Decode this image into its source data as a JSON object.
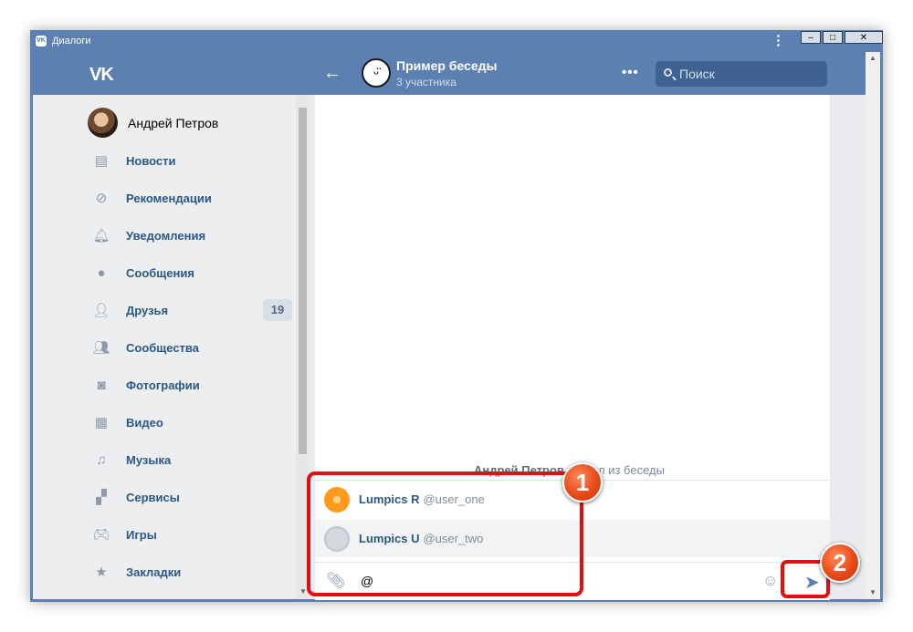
{
  "window": {
    "title": "Диалоги",
    "logo": "VK"
  },
  "header": {
    "logo": "VK",
    "chat_title": "Пример беседы",
    "chat_subtitle": "3 участника",
    "more": "•••",
    "search_placeholder": "Поиск",
    "back_icon": "arrow-left-icon"
  },
  "sidebar": {
    "profile_name": "Андрей Петров",
    "items": [
      {
        "label": "Новости",
        "icon": "news-icon"
      },
      {
        "label": "Рекомендации",
        "icon": "compass-icon"
      },
      {
        "label": "Уведомления",
        "icon": "bell-icon"
      },
      {
        "label": "Сообщения",
        "icon": "message-icon"
      },
      {
        "label": "Друзья",
        "icon": "user-icon",
        "badge": "19"
      },
      {
        "label": "Сообщества",
        "icon": "users-icon"
      },
      {
        "label": "Фотографии",
        "icon": "camera-icon"
      },
      {
        "label": "Видео",
        "icon": "video-icon"
      },
      {
        "label": "Музыка",
        "icon": "music-icon"
      },
      {
        "label": "Сервисы",
        "icon": "services-icon"
      },
      {
        "label": "Игры",
        "icon": "gamepad-icon"
      },
      {
        "label": "Закладки",
        "icon": "star-icon"
      }
    ]
  },
  "chat": {
    "service_message": {
      "name": "Андрей Петров",
      "text": " вышел из беседы"
    },
    "suggestions": [
      {
        "name": "Lumpics R",
        "handle": "@user_one"
      },
      {
        "name": "Lumpics U",
        "handle": "@user_two"
      }
    ],
    "composer_value": "@"
  },
  "annotations": {
    "callout_1": "1",
    "callout_2": "2"
  },
  "colors": {
    "header": "#5b80b1",
    "link": "#2a5885",
    "highlight": "#e20f0f",
    "callout": "#e84a18"
  }
}
